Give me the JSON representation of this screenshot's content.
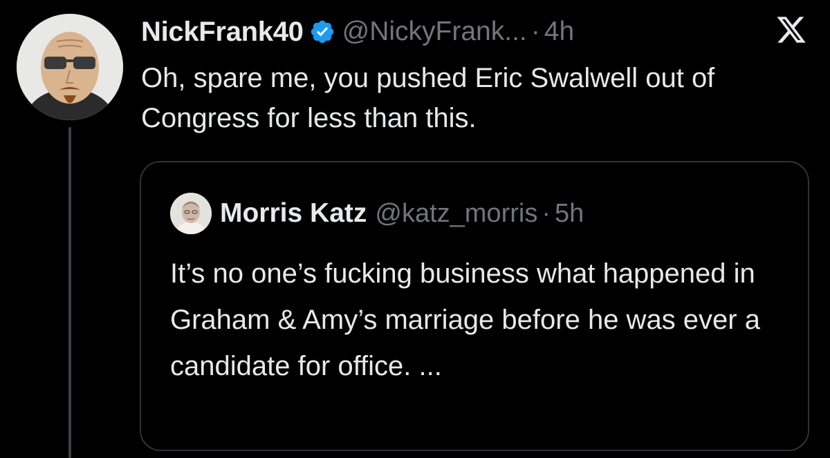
{
  "tweet": {
    "display_name": "NickFrank40",
    "handle": "@NickyFrank...",
    "separator": "·",
    "timestamp": "4h",
    "verified": true,
    "text": "Oh, spare me, you pushed Eric Swalwell out of Congress for less than this."
  },
  "quoted_tweet": {
    "display_name": "Morris Katz",
    "handle": "@katz_morris",
    "separator": "·",
    "timestamp": "5h",
    "text": "It’s no one’s fucking business what happened in Graham & Amy’s marriage before he was ever a candidate for office. ..."
  },
  "icons": {
    "verified": "verified-badge-icon",
    "platform": "x-logo-icon"
  },
  "colors": {
    "background": "#000000",
    "primary_text": "#e7e9ea",
    "secondary_text": "#71767b",
    "verified_blue": "#1d9bf0",
    "border": "#2f3336",
    "thread_line": "#3e4144"
  }
}
